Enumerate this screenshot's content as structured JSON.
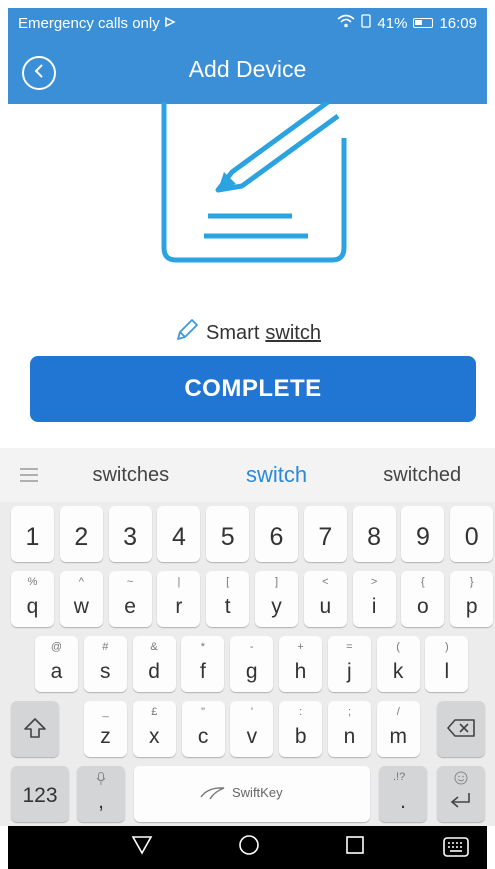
{
  "status_bar": {
    "carrier": "Emergency calls only",
    "battery_percent": "41%",
    "time": "16:09"
  },
  "header": {
    "title": "Add Device"
  },
  "content": {
    "device_name_prefix": "Smart",
    "device_name_word": "switch",
    "complete_label": "COMPLETE"
  },
  "keyboard": {
    "suggestions": [
      "switches",
      "switch",
      "switched"
    ],
    "row_numbers": [
      "1",
      "2",
      "3",
      "4",
      "5",
      "6",
      "7",
      "8",
      "9",
      "0"
    ],
    "row1": [
      {
        "main": "q",
        "sub": "%"
      },
      {
        "main": "w",
        "sub": "^"
      },
      {
        "main": "e",
        "sub": "~"
      },
      {
        "main": "r",
        "sub": "|"
      },
      {
        "main": "t",
        "sub": "["
      },
      {
        "main": "y",
        "sub": "]"
      },
      {
        "main": "u",
        "sub": "<"
      },
      {
        "main": "i",
        "sub": ">"
      },
      {
        "main": "o",
        "sub": "{"
      },
      {
        "main": "p",
        "sub": "}"
      }
    ],
    "row2": [
      {
        "main": "a",
        "sub": "@"
      },
      {
        "main": "s",
        "sub": "#"
      },
      {
        "main": "d",
        "sub": "&"
      },
      {
        "main": "f",
        "sub": "*"
      },
      {
        "main": "g",
        "sub": "-"
      },
      {
        "main": "h",
        "sub": "+"
      },
      {
        "main": "j",
        "sub": "="
      },
      {
        "main": "k",
        "sub": "("
      },
      {
        "main": "l",
        "sub": ")"
      }
    ],
    "row3": [
      {
        "main": "z",
        "sub": "_"
      },
      {
        "main": "x",
        "sub": "£"
      },
      {
        "main": "c",
        "sub": "\""
      },
      {
        "main": "v",
        "sub": "'"
      },
      {
        "main": "b",
        "sub": ":"
      },
      {
        "main": "n",
        "sub": ";"
      },
      {
        "main": "m",
        "sub": "/"
      }
    ],
    "symbols_key": "123",
    "comma_key": ",",
    "space_brand": "SwiftKey",
    "period_key": ".",
    "punct_hint": ".!?"
  },
  "icons": {
    "back": "back-circle-icon",
    "pencil": "pencil-icon",
    "shift": "shift-icon",
    "backspace": "backspace-icon",
    "enter": "enter-icon",
    "mic": "microphone-icon",
    "emoji": "emoji-icon"
  },
  "colors": {
    "accent": "#3b8fd6",
    "button": "#2176d3",
    "suggestion_active": "#2a8ad8",
    "illustration": "#2ba3e0"
  }
}
